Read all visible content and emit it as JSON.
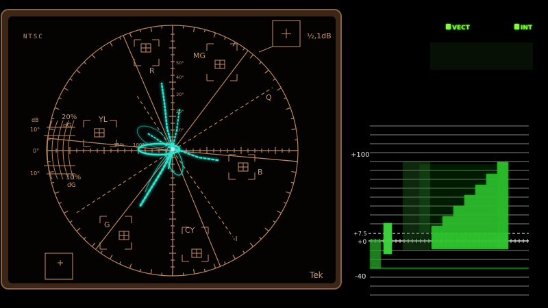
{
  "vectorscope": {
    "standard": "NTSC",
    "gain_label": "½,1dB",
    "brand": "Tek",
    "targets": {
      "r": "R",
      "mg": "MG",
      "b": "B",
      "cy": "CY",
      "g": "G",
      "yl": "YL"
    },
    "axes": {
      "q": "Q",
      "i": "-I"
    },
    "phase_labels": {
      "deg50": "50°",
      "deg40": "40°",
      "deg30": "30°",
      "deg20": "20°",
      "deg10": "10°"
    },
    "side_scale": {
      "db": "dB",
      "ten_deg": "10°",
      "zero_deg": "0°",
      "ten_deg_low": "10°",
      "twenty_pct": "20%",
      "dg_top": "dG",
      "ten_pct": "10%",
      "dg_bottom": "dG"
    },
    "pct75": "75%",
    "pct100": "100%"
  },
  "monitor_buttons": {
    "vect": "VECT",
    "int": "INT",
    "indicator_color": "#7dff3c"
  },
  "waveform": {
    "label_100": "+100",
    "label_7_5": "+7.5",
    "label_0": "+0",
    "label_neg40": "-40"
  },
  "colors": {
    "graticule": "#b98763",
    "bezel": "#5a3a28",
    "trace": "#2ee6d0",
    "waveform": "#3dd33d"
  }
}
